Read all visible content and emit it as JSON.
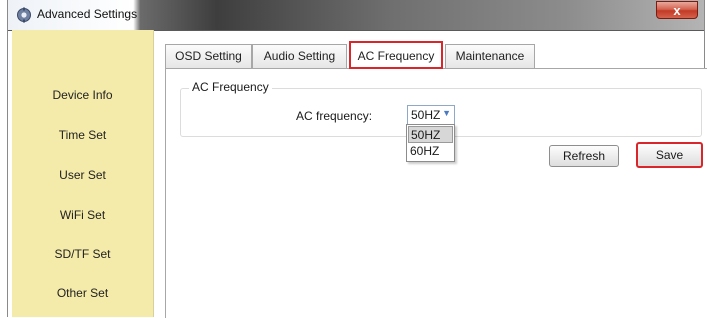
{
  "window": {
    "title": "Advanced Settings",
    "close_label": "x",
    "app_icon": "settings-app-icon"
  },
  "sidebar": {
    "items": [
      {
        "label": "Device Info"
      },
      {
        "label": "Time Set"
      },
      {
        "label": "User Set"
      },
      {
        "label": "WiFi Set"
      },
      {
        "label": "SD/TF Set"
      },
      {
        "label": "Other Set"
      }
    ]
  },
  "tabs": [
    {
      "label": "OSD Setting",
      "active": false
    },
    {
      "label": "Audio Setting",
      "active": false
    },
    {
      "label": "AC Frequency",
      "active": true
    },
    {
      "label": "Maintenance",
      "active": false
    }
  ],
  "group": {
    "title": "AC Frequency",
    "field_label": "AC frequency:",
    "selected_value": "50HZ",
    "options": [
      "50HZ",
      "60HZ"
    ]
  },
  "buttons": {
    "refresh_label": "Refresh",
    "save_label": "Save"
  },
  "colors": {
    "sidebar_bg": "#f4eaa9",
    "highlight_red": "#d9262b",
    "close_red": "#c23a26"
  }
}
